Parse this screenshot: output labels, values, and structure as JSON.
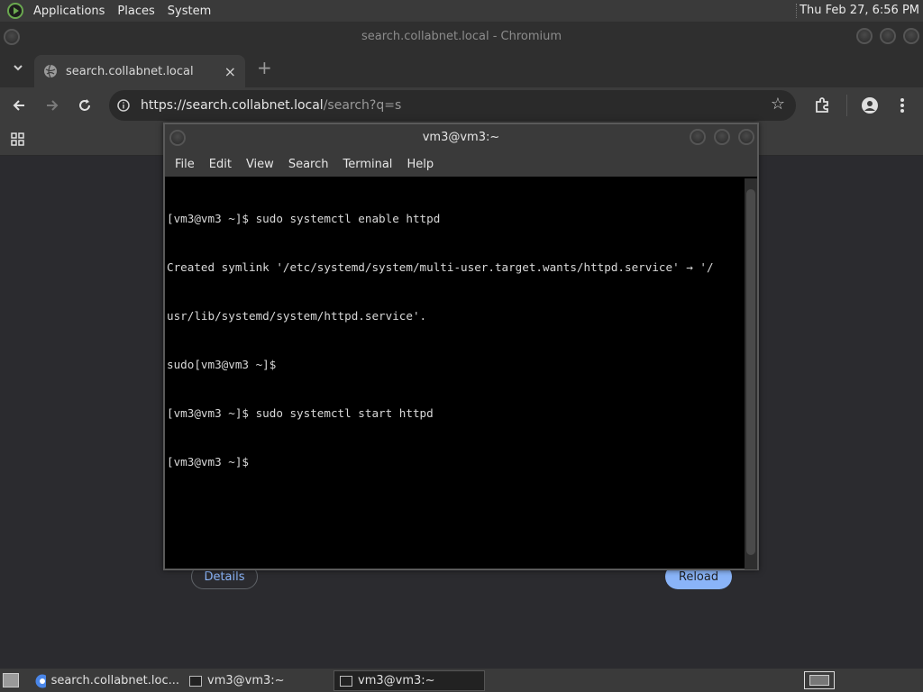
{
  "top_panel": {
    "menus": [
      "Applications",
      "Places",
      "System"
    ],
    "clock": "Thu Feb 27,  6:56 PM"
  },
  "browser": {
    "window_title": "search.collabnet.local - Chromium",
    "tab_title": "search.collabnet.local",
    "url_host": "https://search.collabnet.local",
    "url_path": "/search?q=s",
    "page_buttons": {
      "details": "Details",
      "reload": "Reload"
    }
  },
  "terminal": {
    "title": "vm3@vm3:~",
    "menu": [
      "File",
      "Edit",
      "View",
      "Search",
      "Terminal",
      "Help"
    ],
    "lines": [
      "[vm3@vm3 ~]$ sudo systemctl enable httpd",
      "Created symlink '/etc/systemd/system/multi-user.target.wants/httpd.service' → '/",
      "usr/lib/systemd/system/httpd.service'.",
      "sudo[vm3@vm3 ~]$",
      "[vm3@vm3 ~]$ sudo systemctl start httpd",
      "[vm3@vm3 ~]$"
    ]
  },
  "taskbar": {
    "tasks": [
      "search.collabnet.loc...",
      "vm3@vm3:~",
      "vm3@vm3:~"
    ]
  },
  "colors": {
    "reload_button": "#8ab4f8",
    "terminal_bg": "#000000"
  }
}
